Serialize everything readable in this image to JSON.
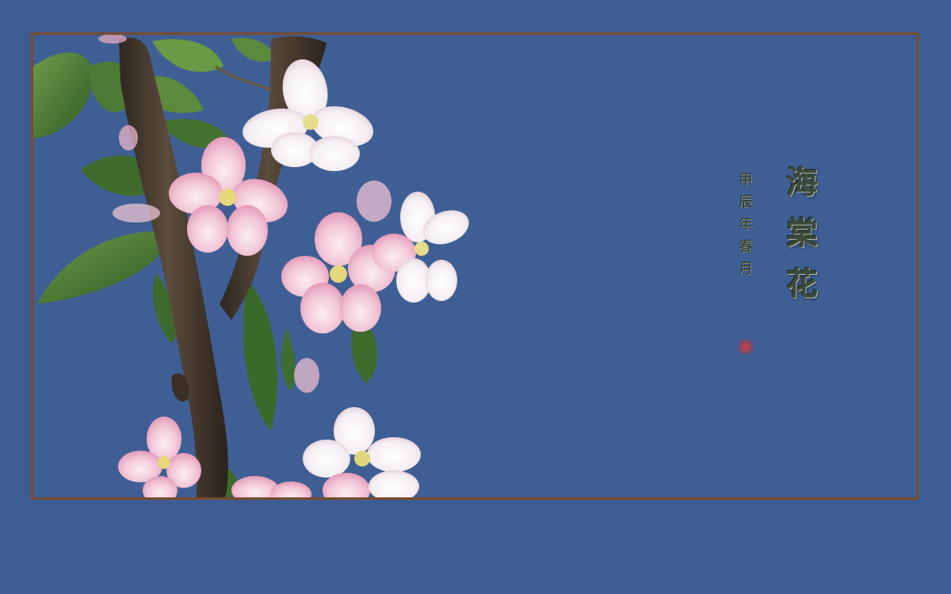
{
  "artwork": {
    "title_chars": [
      "海",
      "棠",
      "花"
    ],
    "date_chars": [
      "甲",
      "辰",
      "年",
      "春",
      "月"
    ],
    "seal_color": "#c83c3c",
    "border_color": "#7a4a2a",
    "background_color": "#3d5c92"
  },
  "icons": {
    "seal": "red-seal-stamp"
  }
}
